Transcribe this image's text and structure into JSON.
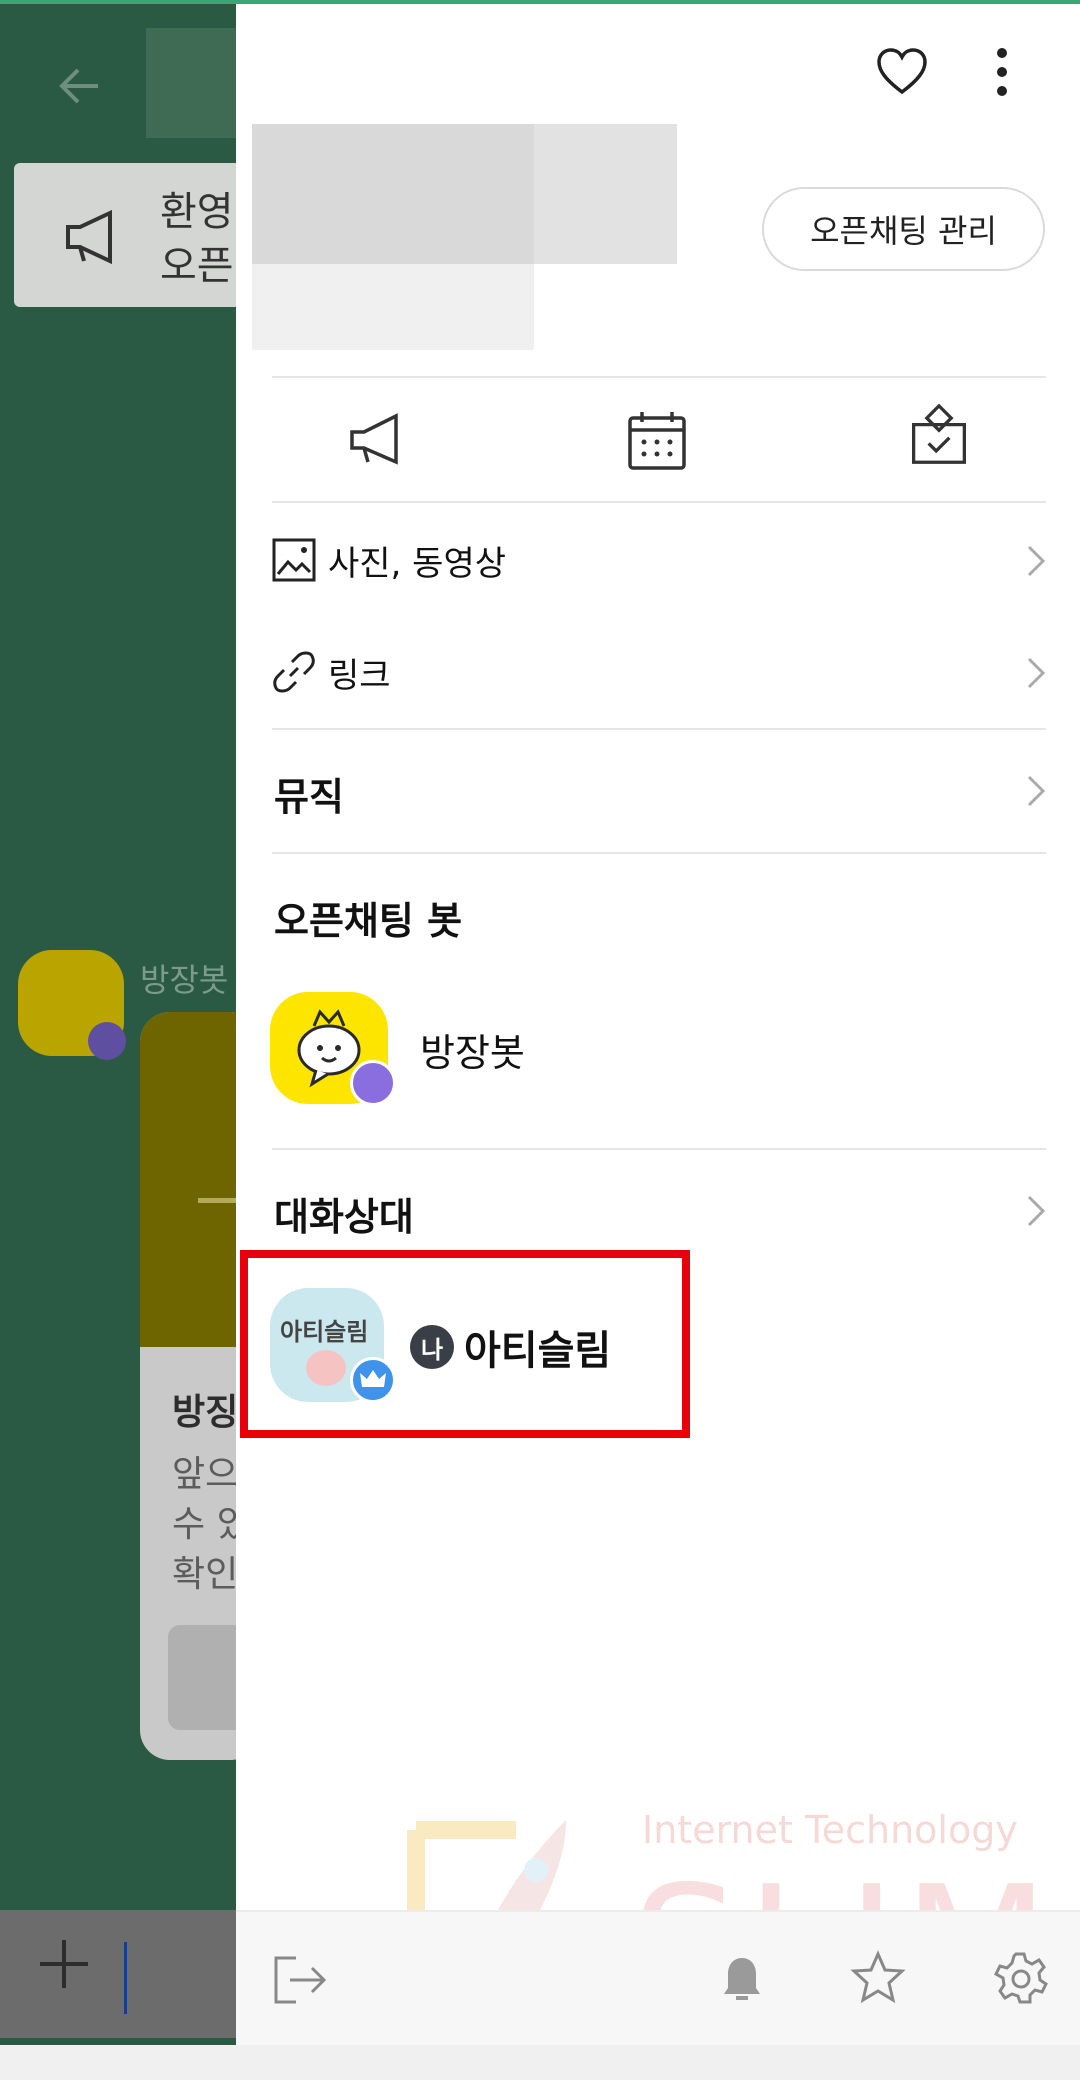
{
  "background_chat": {
    "notice_line1": "환영",
    "notice_line2": "오픈",
    "sender": "방장봇",
    "message_title": "방징",
    "message_body": "앞으\n수 있\n확인"
  },
  "drawer": {
    "manage_button": "오픈채팅 관리",
    "menu": {
      "media": "사진, 동영상",
      "links": "링크",
      "music": "뮤직"
    },
    "bot_section_title": "오픈채팅 봇",
    "bot_name": "방장봇",
    "members_title": "대화상대",
    "me_tag": "나",
    "me_name": "아티슬림",
    "me_avatar_text": "아티슬림"
  },
  "watermark": {
    "text": "Internet Technology",
    "brand": "SLIM"
  },
  "colors": {
    "highlight": "#e8000a",
    "bot_yellow": "#fee500",
    "bot_badge": "#8a6ee0",
    "owner_badge": "#3f93ea"
  }
}
